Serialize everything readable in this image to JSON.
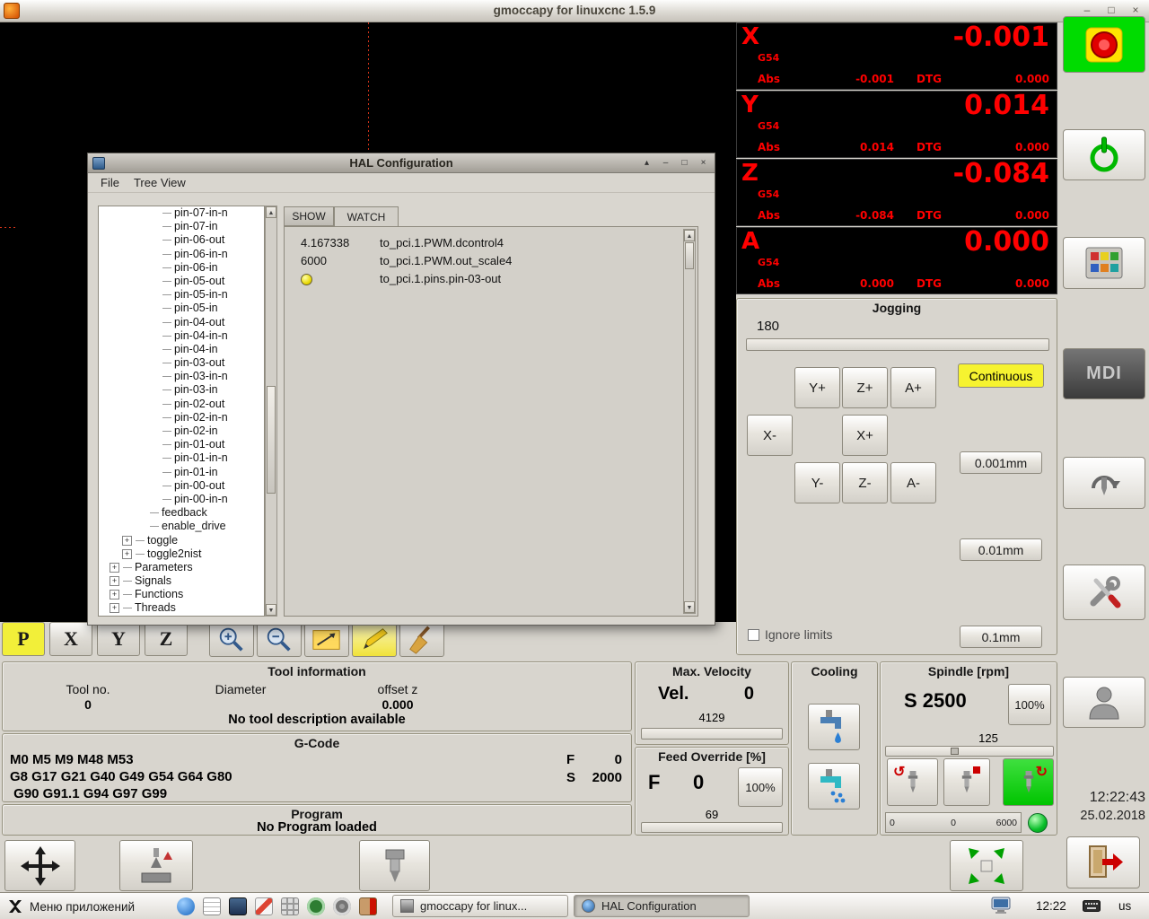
{
  "window": {
    "title": "gmoccapy for linuxcnc  1.5.9",
    "controls": {
      "minimize": "–",
      "maximize": "□",
      "close": "×"
    }
  },
  "hal": {
    "title": "HAL Configuration",
    "menu": [
      "File",
      "Tree View"
    ],
    "controls": {
      "shade": "▴",
      "minimize": "–",
      "maximize": "□",
      "close": "×"
    },
    "expander_glyph": "+",
    "scrollbar": {
      "up": "▲",
      "down": "▼"
    },
    "tabs": [
      {
        "label": "SHOW",
        "active": false
      },
      {
        "label": "WATCH",
        "active": true
      }
    ],
    "tree": [
      {
        "label": "pin-07-in-n",
        "level": 5,
        "expandable": false
      },
      {
        "label": "pin-07-in",
        "level": 5,
        "expandable": false
      },
      {
        "label": "pin-06-out",
        "level": 5,
        "expandable": false
      },
      {
        "label": "pin-06-in-n",
        "level": 5,
        "expandable": false
      },
      {
        "label": "pin-06-in",
        "level": 5,
        "expandable": false
      },
      {
        "label": "pin-05-out",
        "level": 5,
        "expandable": false
      },
      {
        "label": "pin-05-in-n",
        "level": 5,
        "expandable": false
      },
      {
        "label": "pin-05-in",
        "level": 5,
        "expandable": false
      },
      {
        "label": "pin-04-out",
        "level": 5,
        "expandable": false
      },
      {
        "label": "pin-04-in-n",
        "level": 5,
        "expandable": false
      },
      {
        "label": "pin-04-in",
        "level": 5,
        "expandable": false
      },
      {
        "label": "pin-03-out",
        "level": 5,
        "expandable": false
      },
      {
        "label": "pin-03-in-n",
        "level": 5,
        "expandable": false
      },
      {
        "label": "pin-03-in",
        "level": 5,
        "expandable": false
      },
      {
        "label": "pin-02-out",
        "level": 5,
        "expandable": false
      },
      {
        "label": "pin-02-in-n",
        "level": 5,
        "expandable": false
      },
      {
        "label": "pin-02-in",
        "level": 5,
        "expandable": false
      },
      {
        "label": "pin-01-out",
        "level": 5,
        "expandable": false
      },
      {
        "label": "pin-01-in-n",
        "level": 5,
        "expandable": false
      },
      {
        "label": "pin-01-in",
        "level": 5,
        "expandable": false
      },
      {
        "label": "pin-00-out",
        "level": 5,
        "expandable": false
      },
      {
        "label": "pin-00-in-n",
        "level": 5,
        "expandable": false
      },
      {
        "label": "feedback",
        "level": 4,
        "expandable": false
      },
      {
        "label": "enable_drive",
        "level": 4,
        "expandable": false
      },
      {
        "label": "toggle",
        "level": 3,
        "expandable": true
      },
      {
        "label": "toggle2nist",
        "level": 3,
        "expandable": true
      },
      {
        "label": "Parameters",
        "level": 2,
        "expandable": true
      },
      {
        "label": "Signals",
        "level": 2,
        "expandable": true
      },
      {
        "label": "Functions",
        "level": 2,
        "expandable": true
      },
      {
        "label": "Threads",
        "level": 2,
        "expandable": true
      }
    ],
    "watch": [
      {
        "value": "4.167338",
        "pin": "to_pci.1.PWM.dcontrol4",
        "led": null
      },
      {
        "value": "6000",
        "pin": "to_pci.1.PWM.out_scale4",
        "led": null
      },
      {
        "value": "",
        "pin": "to_pci.1.pins.pin-03-out",
        "led": "yellow"
      }
    ]
  },
  "dro": {
    "axes": [
      {
        "letter": "X",
        "system": "G54",
        "value": "-0.001",
        "abs_label": "Abs",
        "abs": "-0.001",
        "dtg_label": "DTG",
        "dtg": "0.000"
      },
      {
        "letter": "Y",
        "system": "G54",
        "value": "0.014",
        "abs_label": "Abs",
        "abs": "0.014",
        "dtg_label": "DTG",
        "dtg": "0.000"
      },
      {
        "letter": "Z",
        "system": "G54",
        "value": "-0.084",
        "abs_label": "Abs",
        "abs": "-0.084",
        "dtg_label": "DTG",
        "dtg": "0.000"
      },
      {
        "letter": "A",
        "system": "G54",
        "value": "0.000",
        "abs_label": "Abs",
        "abs": "0.000",
        "dtg_label": "DTG",
        "dtg": "0.000"
      }
    ]
  },
  "jogging": {
    "title": "Jogging",
    "speed": "180",
    "grid": [
      [
        null,
        "Y+",
        "Z+",
        "A+"
      ],
      [
        "X-",
        null,
        "X+",
        null
      ],
      [
        null,
        "Y-",
        "Z-",
        "A-"
      ]
    ],
    "continuous": "Continuous",
    "increments": [
      "0.001mm",
      "0.01mm",
      "0.1mm"
    ],
    "ignore_limits": "Ignore limits"
  },
  "axis_tabs": [
    "P",
    "X",
    "Y",
    "Z"
  ],
  "preview_toolbar": [
    "zoom-in",
    "zoom-out",
    "dimensions",
    "edit",
    "clear"
  ],
  "tool_info": {
    "title": "Tool information",
    "tool_no_label": "Tool no.",
    "tool_no": "0",
    "diameter_label": "Diameter",
    "offset_z_label": "offset z",
    "offset_z": "0.000",
    "description": "No tool description available"
  },
  "gcode": {
    "title": "G-Code",
    "lines": [
      "M0 M5 M9 M48 M53",
      "G8 G17 G21 G40 G49 G54 G64 G80",
      " G90 G91.1 G94 G97 G99"
    ],
    "f_label": "F",
    "f_value": "0",
    "s_label": "S",
    "s_value": "2000"
  },
  "program": {
    "title": "Program",
    "status": "No Program loaded"
  },
  "max_velocity": {
    "title": "Max. Velocity",
    "vel_label": "Vel.",
    "vel_value": "0",
    "slider_value": "4129"
  },
  "feed_override": {
    "title": "Feed Override [%]",
    "f_label": "F",
    "f_value": "0",
    "percent": "100%",
    "slider_value": "69"
  },
  "cooling": {
    "title": "Cooling"
  },
  "spindle": {
    "title": "Spindle [rpm]",
    "s_value": "S 2500",
    "percent": "100%",
    "slider_value": "125",
    "bar_left": "0",
    "bar_mid": "0",
    "bar_right": "6000",
    "ccw_glyph": "↺",
    "cw_glyph": "↻"
  },
  "mdi_label": "MDI",
  "clock": {
    "time": "12:22:43",
    "date": "25.02.2018"
  },
  "taskbar": {
    "menu_label": "Меню приложений",
    "icons": [
      "browser",
      "notes",
      "display",
      "editor",
      "calculator",
      "workspace",
      "settings",
      "logout"
    ],
    "windows": [
      {
        "label": "gmoccapy for linux...",
        "active": false
      },
      {
        "label": "HAL Configuration",
        "active": true
      }
    ],
    "time": "12:22",
    "layout": "us"
  },
  "colors": {
    "dro_red": "#ff0000",
    "continuous_yellow": "#f6f330",
    "estop_green": "#00dc00",
    "active_green": "#00c400"
  }
}
